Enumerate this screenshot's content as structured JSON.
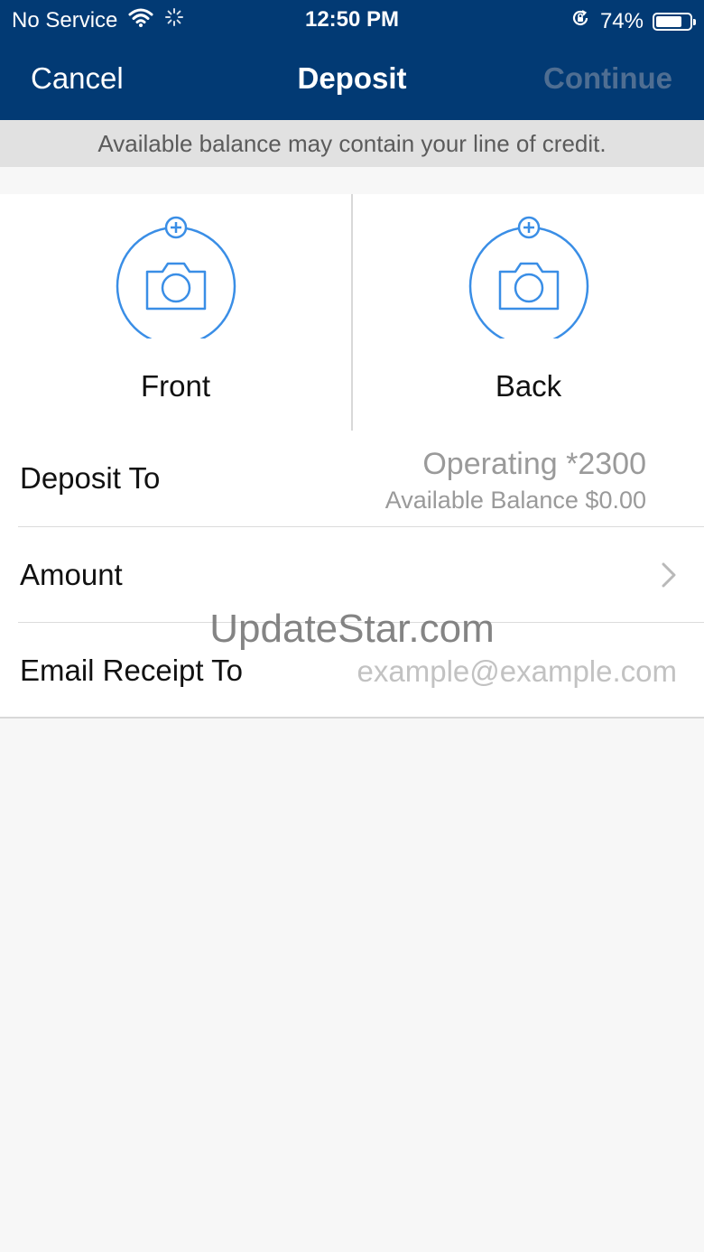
{
  "status_bar": {
    "carrier": "No Service",
    "time": "12:50 PM",
    "battery": "74%",
    "battery_level": 0.74
  },
  "nav": {
    "cancel": "Cancel",
    "title": "Deposit",
    "continue": "Continue"
  },
  "banner": "Available balance may contain your line of credit.",
  "capture": {
    "front_label": "Front",
    "back_label": "Back"
  },
  "form": {
    "deposit_to": {
      "label": "Deposit To",
      "account": "Operating *2300",
      "balance": "Available Balance $0.00"
    },
    "amount": {
      "label": "Amount"
    },
    "email": {
      "label": "Email Receipt To",
      "placeholder": "example@example.com"
    }
  },
  "watermark": "UpdateStar.com",
  "colors": {
    "nav_bg": "#023a74",
    "accent": "#3a8ee6",
    "continue_disabled": "#4f6e92"
  }
}
